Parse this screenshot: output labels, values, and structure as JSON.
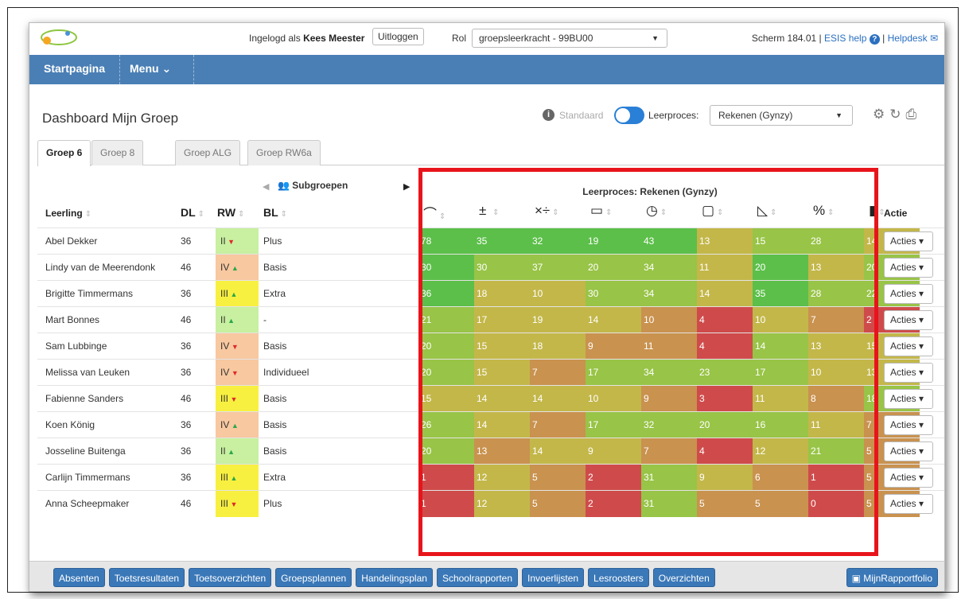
{
  "top": {
    "login_prefix": "Ingelogd als",
    "user": "Kees Meester",
    "logout": "Uitloggen",
    "rol_label": "Rol",
    "rol_value": "groepsleerkracht - 99BU00",
    "screen": "Scherm 184.01 |",
    "help": "ESIS help",
    "helpdesk": "Helpdesk"
  },
  "nav": {
    "home": "Startpagina",
    "menu": "Menu"
  },
  "page": {
    "title": "Dashboard Mijn Groep",
    "standaard": "Standaard",
    "leerproces_label": "Leerproces:",
    "leerproces_value": "Rekenen (Gynzy)"
  },
  "tabs": [
    "Groep 6",
    "Groep 8",
    "Groep ALG",
    "Groep RW6a"
  ],
  "headers": {
    "leerling": "Leerling",
    "dl": "DL",
    "rw": "RW",
    "bl": "BL",
    "subgroepen": "Subgroepen",
    "leerproces": "Leerproces: Rekenen (Gynzy)",
    "actie": "Actie",
    "acties_label": "Acties"
  },
  "score_icons": [
    "arc-icon",
    "plus-minus-icon",
    "times-divide-icon",
    "money-icon",
    "clock-icon",
    "cube-icon",
    "ruler-icon",
    "percent-table-icon",
    "bar-chart-icon"
  ],
  "colors": {
    "s_green": "#5cbf4a",
    "s_lgreen": "#98c447",
    "s_olive": "#c3b74a",
    "s_tan": "#c9924f",
    "s_red": "#cf4b4b",
    "rw_green": "#c8f0a0",
    "rw_orange": "#f8c8a0",
    "rw_yellow": "#f8f040"
  },
  "rows": [
    {
      "name": "Abel Dekker",
      "dl": "36",
      "rw": "II",
      "trend": "down",
      "rwc": "rw_green",
      "bl": "Plus",
      "scores": [
        "78",
        "35",
        "32",
        "19",
        "43",
        "13",
        "15",
        "28",
        "14"
      ],
      "c": [
        "s_green",
        "s_green",
        "s_green",
        "s_green",
        "s_green",
        "s_olive",
        "s_lgreen",
        "s_lgreen",
        "s_olive"
      ]
    },
    {
      "name": "Lindy van de Meerendonk",
      "dl": "46",
      "rw": "IV",
      "trend": "up",
      "rwc": "rw_orange",
      "bl": "Basis",
      "scores": [
        "30",
        "30",
        "37",
        "20",
        "34",
        "11",
        "20",
        "13",
        "20"
      ],
      "c": [
        "s_green",
        "s_lgreen",
        "s_lgreen",
        "s_lgreen",
        "s_lgreen",
        "s_olive",
        "s_green",
        "s_olive",
        "s_lgreen"
      ]
    },
    {
      "name": "Brigitte Timmermans",
      "dl": "36",
      "rw": "III",
      "trend": "up",
      "rwc": "rw_yellow",
      "bl": "Extra",
      "scores": [
        "36",
        "18",
        "10",
        "30",
        "34",
        "14",
        "35",
        "28",
        "22"
      ],
      "c": [
        "s_green",
        "s_olive",
        "s_olive",
        "s_lgreen",
        "s_lgreen",
        "s_olive",
        "s_green",
        "s_lgreen",
        "s_lgreen"
      ]
    },
    {
      "name": "Mart Bonnes",
      "dl": "46",
      "rw": "II",
      "trend": "up",
      "rwc": "rw_green",
      "bl": "-",
      "scores": [
        "21",
        "17",
        "19",
        "14",
        "10",
        "4",
        "10",
        "7",
        "2"
      ],
      "c": [
        "s_lgreen",
        "s_olive",
        "s_olive",
        "s_olive",
        "s_tan",
        "s_red",
        "s_olive",
        "s_tan",
        "s_red"
      ]
    },
    {
      "name": "Sam Lubbinge",
      "dl": "36",
      "rw": "IV",
      "trend": "down",
      "rwc": "rw_orange",
      "bl": "Basis",
      "scores": [
        "20",
        "15",
        "18",
        "9",
        "11",
        "4",
        "14",
        "13",
        "15"
      ],
      "c": [
        "s_lgreen",
        "s_olive",
        "s_olive",
        "s_tan",
        "s_tan",
        "s_red",
        "s_lgreen",
        "s_olive",
        "s_olive"
      ]
    },
    {
      "name": "Melissa van Leuken",
      "dl": "36",
      "rw": "IV",
      "trend": "down",
      "rwc": "rw_orange",
      "bl": "Individueel",
      "scores": [
        "20",
        "15",
        "7",
        "17",
        "34",
        "23",
        "17",
        "10",
        "13"
      ],
      "c": [
        "s_lgreen",
        "s_olive",
        "s_tan",
        "s_lgreen",
        "s_lgreen",
        "s_lgreen",
        "s_lgreen",
        "s_olive",
        "s_olive"
      ]
    },
    {
      "name": "Fabienne Sanders",
      "dl": "46",
      "rw": "III",
      "trend": "down",
      "rwc": "rw_yellow",
      "bl": "Basis",
      "scores": [
        "15",
        "14",
        "14",
        "10",
        "9",
        "3",
        "11",
        "8",
        "18"
      ],
      "c": [
        "s_olive",
        "s_olive",
        "s_olive",
        "s_olive",
        "s_tan",
        "s_red",
        "s_olive",
        "s_tan",
        "s_lgreen"
      ]
    },
    {
      "name": "Koen König",
      "dl": "36",
      "rw": "IV",
      "trend": "up",
      "rwc": "rw_orange",
      "bl": "Basis",
      "scores": [
        "26",
        "14",
        "7",
        "17",
        "32",
        "20",
        "16",
        "11",
        "7"
      ],
      "c": [
        "s_lgreen",
        "s_olive",
        "s_tan",
        "s_lgreen",
        "s_lgreen",
        "s_lgreen",
        "s_lgreen",
        "s_olive",
        "s_tan"
      ]
    },
    {
      "name": "Josseline Buitenga",
      "dl": "36",
      "rw": "II",
      "trend": "up",
      "rwc": "rw_green",
      "bl": "Basis",
      "scores": [
        "20",
        "13",
        "14",
        "9",
        "7",
        "4",
        "12",
        "21",
        "5"
      ],
      "c": [
        "s_lgreen",
        "s_tan",
        "s_olive",
        "s_olive",
        "s_tan",
        "s_red",
        "s_olive",
        "s_lgreen",
        "s_tan"
      ]
    },
    {
      "name": "Carlijn Timmermans",
      "dl": "36",
      "rw": "III",
      "trend": "up",
      "rwc": "rw_yellow",
      "bl": "Extra",
      "scores": [
        "1",
        "12",
        "5",
        "2",
        "31",
        "9",
        "6",
        "1",
        "5"
      ],
      "c": [
        "s_red",
        "s_olive",
        "s_tan",
        "s_red",
        "s_lgreen",
        "s_olive",
        "s_tan",
        "s_red",
        "s_tan"
      ]
    },
    {
      "name": "Anna Scheepmaker",
      "dl": "46",
      "rw": "III",
      "trend": "down",
      "rwc": "rw_yellow",
      "bl": "Plus",
      "scores": [
        "1",
        "12",
        "5",
        "2",
        "31",
        "5",
        "5",
        "0",
        "5"
      ],
      "c": [
        "s_red",
        "s_olive",
        "s_tan",
        "s_red",
        "s_lgreen",
        "s_tan",
        "s_tan",
        "s_red",
        "s_tan"
      ]
    }
  ],
  "bottom": [
    "Absenten",
    "Toetsresultaten",
    "Toetsoverzichten",
    "Groepsplannen",
    "Handelingsplan",
    "Schoolrapporten",
    "Invoerlijsten",
    "Lesroosters",
    "Overzichten"
  ],
  "bottom_right": "MijnRapportfolio"
}
